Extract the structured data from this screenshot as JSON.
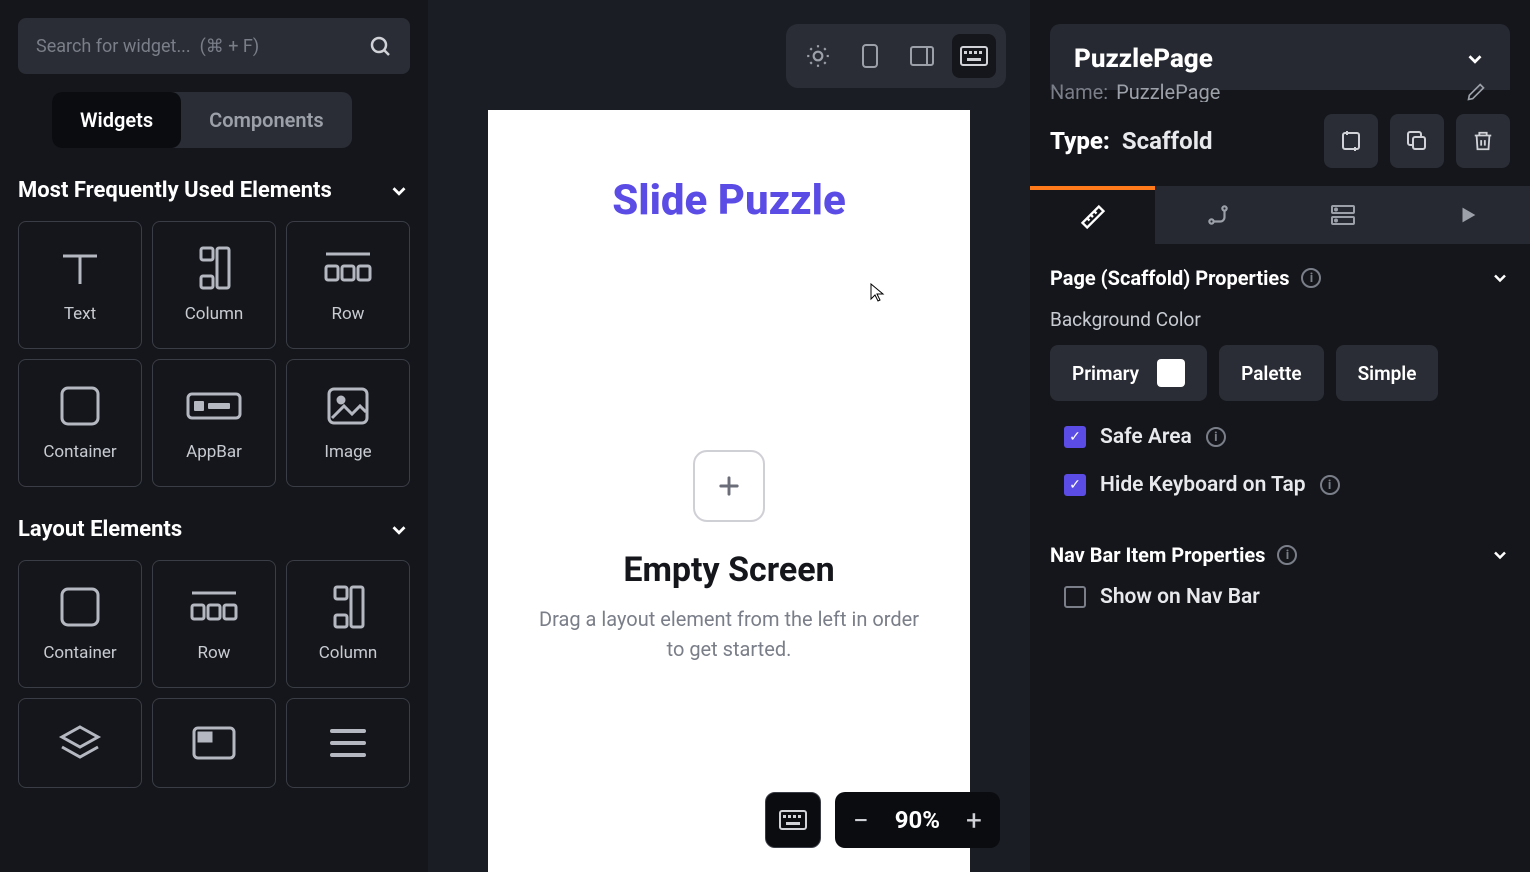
{
  "search": {
    "placeholder": "Search for widget...  (⌘ + F)"
  },
  "tabs": {
    "widgets": "Widgets",
    "components": "Components"
  },
  "sections": {
    "frequent": "Most Frequently Used Elements",
    "layout": "Layout Elements"
  },
  "widgets_frequent": [
    {
      "label": "Text"
    },
    {
      "label": "Column"
    },
    {
      "label": "Row"
    },
    {
      "label": "Container"
    },
    {
      "label": "AppBar"
    },
    {
      "label": "Image"
    }
  ],
  "widgets_layout": [
    {
      "label": "Container"
    },
    {
      "label": "Row"
    },
    {
      "label": "Column"
    },
    {
      "label": "Stack"
    },
    {
      "label": "Card"
    },
    {
      "label": "ListView"
    }
  ],
  "canvas": {
    "title": "Slide Puzzle",
    "empty_title": "Empty Screen",
    "empty_sub": "Drag a layout element from the left in order to get started."
  },
  "zoom": {
    "value": "90%"
  },
  "right": {
    "page_name": "PuzzlePage",
    "name_label": "Name:",
    "name_value": "PuzzlePage",
    "type_label": "Type:",
    "type_value": "Scaffold",
    "section1": "Page (Scaffold) Properties",
    "bg_label": "Background Color",
    "chips": {
      "primary": "Primary",
      "palette": "Palette",
      "simple": "Simple"
    },
    "safe_area": "Safe Area",
    "hide_kb": "Hide Keyboard on Tap",
    "section2": "Nav Bar Item Properties",
    "show_nav": "Show on Nav Bar"
  }
}
